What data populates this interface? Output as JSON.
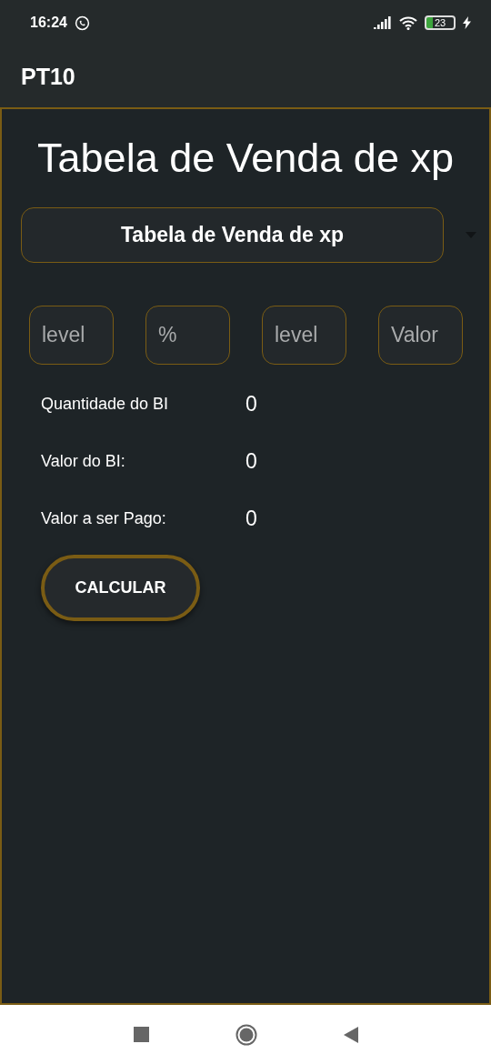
{
  "status_bar": {
    "time": "16:24",
    "battery": "23"
  },
  "app_bar": {
    "title": "PT10"
  },
  "heading": "Tabela de Venda de xp",
  "dropdown": {
    "value": "Tabela de Venda de xp"
  },
  "fields": [
    {
      "placeholder": "level"
    },
    {
      "placeholder": "%"
    },
    {
      "placeholder": "level"
    },
    {
      "placeholder": "Valor"
    }
  ],
  "results": [
    {
      "label": "Quantidade do BI",
      "value": "0"
    },
    {
      "label": "Valor do BI:",
      "value": "0"
    },
    {
      "label": "Valor a ser Pago:",
      "value": "0"
    }
  ],
  "button": "CALCULAR"
}
